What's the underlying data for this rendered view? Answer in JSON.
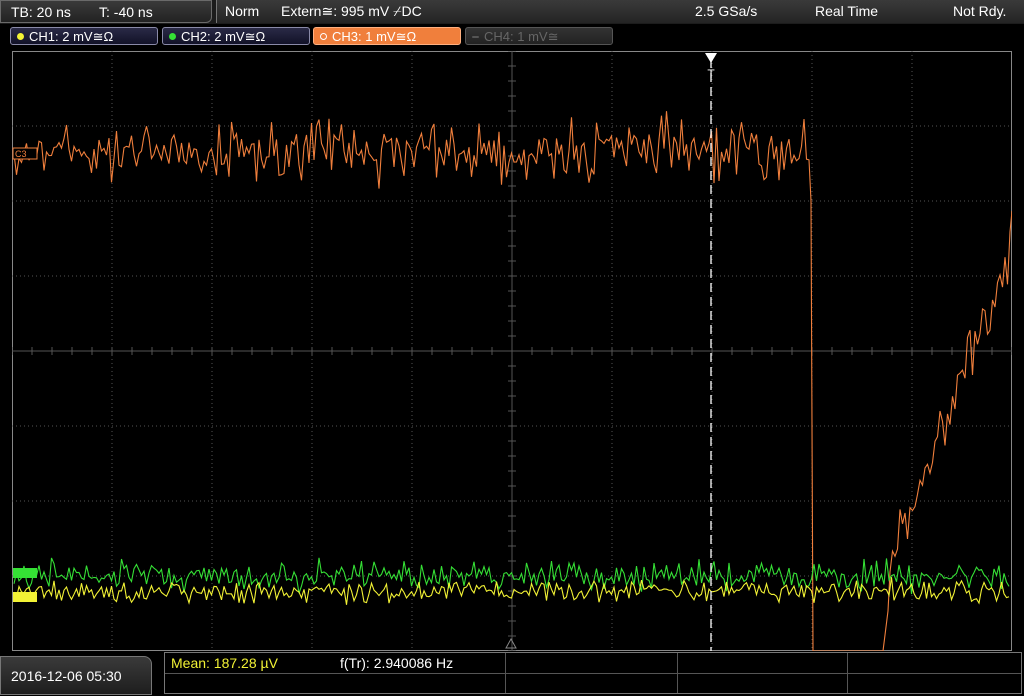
{
  "timebase": {
    "tb": "TB: 20 ns",
    "trig_pos": "T: -40 ns"
  },
  "status": {
    "mode": "Norm",
    "trigger": "Extern≅: 995 mV ⌿DC",
    "sample_rate": "2.5 GSa/s",
    "acq": "Real Time",
    "state": "Not Rdy."
  },
  "channels": [
    {
      "label": "CH1: 2 mV≅Ω",
      "color": "#f2f235"
    },
    {
      "label": "CH2: 2 mV≅Ω",
      "color": "#35e035"
    },
    {
      "label": "CH3: 1 mV≅Ω",
      "color": "#f07f3c"
    },
    {
      "label": "CH4: 1 mV≅",
      "color": "#666666"
    }
  ],
  "markers": {
    "c3": "C3",
    "trigger": "T"
  },
  "date": "2016-12-06 05:30",
  "measurements": {
    "mean": "Mean: 187.28 µV",
    "freq": "f(Tr): 2.940086 Hz"
  },
  "colors": {
    "grid": "#555555",
    "ch3": "#f07f3c",
    "ch2": "#35e035",
    "ch1": "#f2f235",
    "cursor": "#ffffff"
  }
}
